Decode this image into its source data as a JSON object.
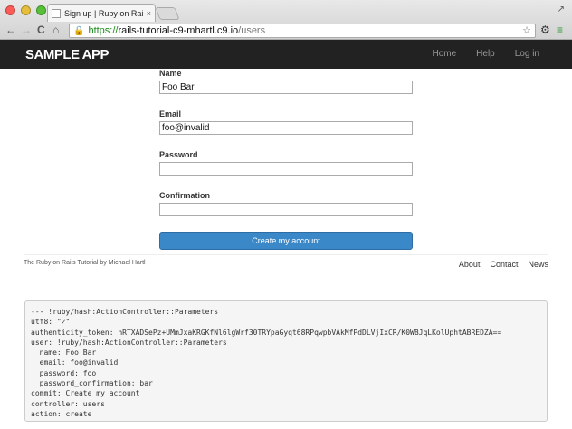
{
  "browser": {
    "tab_title": "Sign up | Ruby on Rails Tut",
    "tab_close": "×",
    "url_scheme": "https://",
    "url_host": "rails-tutorial-c9-mhartl.c9.io",
    "url_path": "/users"
  },
  "icons": {
    "back": "←",
    "forward": "→",
    "reload": "C",
    "home": "⌂",
    "star": "☆",
    "gear": "⚙",
    "menu": "≡",
    "lock": "🔒",
    "fullscreen": "↗"
  },
  "navbar": {
    "brand": "SAMPLE APP",
    "links": [
      "Home",
      "Help",
      "Log in"
    ]
  },
  "form": {
    "name_label": "Name",
    "name_value": "Foo Bar",
    "email_label": "Email",
    "email_value": "foo@invalid",
    "password_label": "Password",
    "password_value": "",
    "confirmation_label": "Confirmation",
    "confirmation_value": "",
    "submit_label": "Create my account"
  },
  "footer": {
    "credit": "The Ruby on Rails Tutorial by Michael Hartl",
    "links": [
      "About",
      "Contact",
      "News"
    ]
  },
  "debug": {
    "lines": [
      "--- !ruby/hash:ActionController::Parameters",
      "utf8: \"✓\"",
      "authenticity_token: hRTXADSePz+UMmJxaKRGKfNl6lgWrf30TRYpaGyqt68RPqwpbVAkMfPdDLVjIxCR/K0WBJqLKolUphtABREDZA==",
      "user: !ruby/hash:ActionController::Parameters",
      "  name: Foo Bar",
      "  email: foo@invalid",
      "  password: foo",
      "  password_confirmation: bar",
      "commit: Create my account",
      "controller: users",
      "action: create"
    ]
  }
}
